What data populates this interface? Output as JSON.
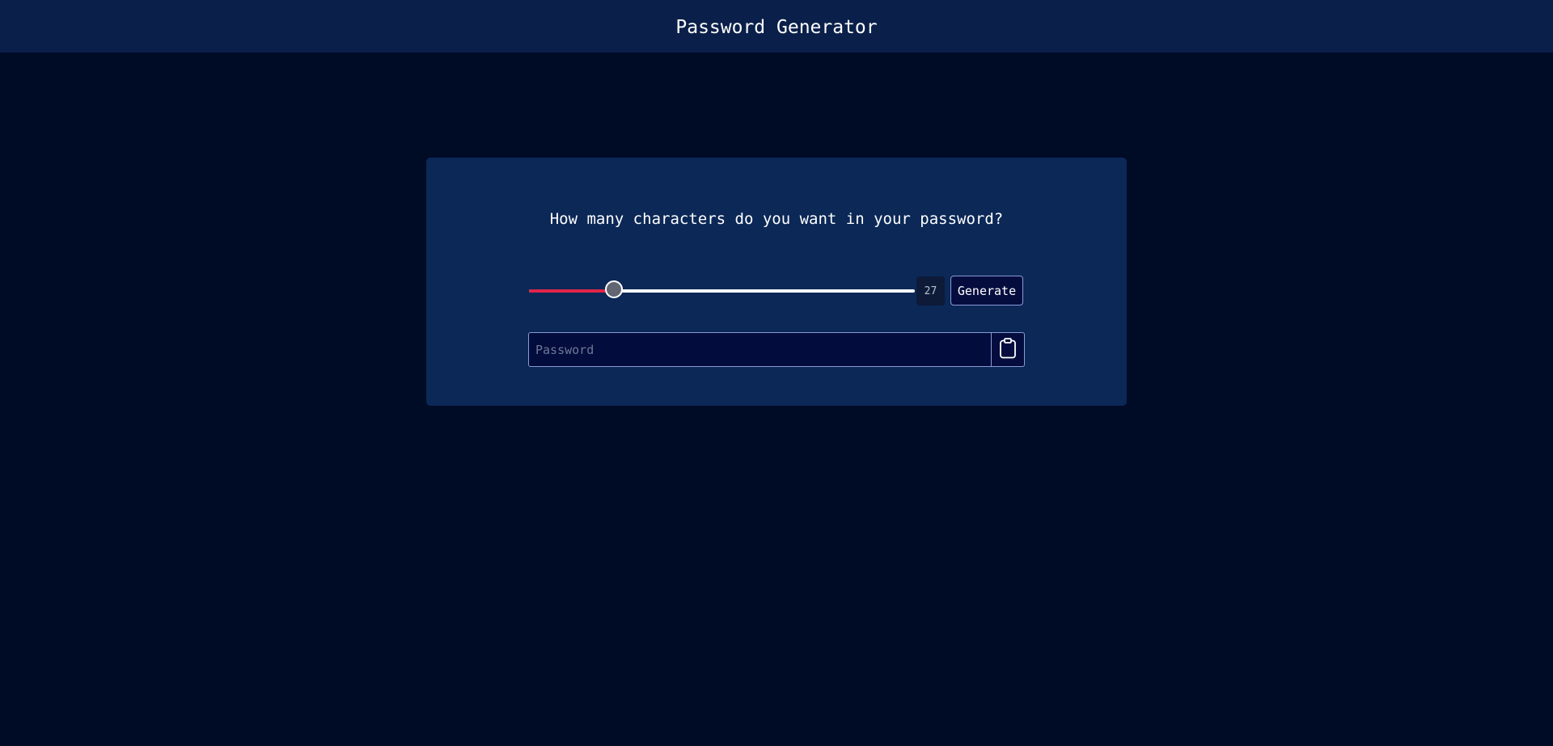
{
  "header": {
    "title": "Password Generator"
  },
  "card": {
    "question": "How many characters do you want in your password?"
  },
  "slider": {
    "fill_fraction": 0.22,
    "fill_color": "#e0254a",
    "track_color": "#ffffff"
  },
  "length": {
    "value": "27"
  },
  "buttons": {
    "generate_label": "Generate",
    "copy_icon": "clipboard-icon"
  },
  "password": {
    "value": "",
    "placeholder": "Password"
  },
  "colors": {
    "background": "#000b26",
    "header": "#0a204a",
    "card": "#0b2857",
    "border": "#8a9bd6"
  }
}
